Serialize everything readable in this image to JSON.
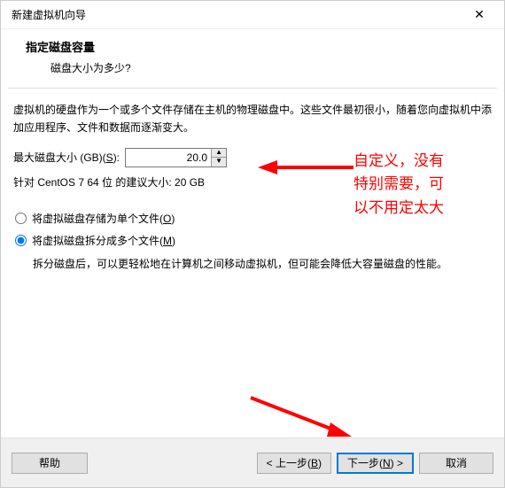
{
  "window": {
    "title": "新建虚拟机向导"
  },
  "header": {
    "title": "指定磁盘容量",
    "subtitle": "磁盘大小为多少?"
  },
  "body": {
    "desc": "虚拟机的硬盘作为一个或多个文件存储在主机的物理磁盘中。这些文件最初很小，随着您向虚拟机中添加应用程序、文件和数据而逐渐变大。",
    "size_label_pre": "最大磁盘大小 (GB)(",
    "size_label_key": "S",
    "size_label_post": "):",
    "size_value": "20.0",
    "suggest": "针对 CentOS 7 64 位 的建议大小: 20 GB",
    "radio_single_pre": "将虚拟磁盘存储为单个文件(",
    "radio_single_key": "O",
    "radio_single_post": ")",
    "radio_split_pre": "将虚拟磁盘拆分成多个文件(",
    "radio_split_key": "M",
    "radio_split_post": ")",
    "split_desc": "拆分磁盘后，可以更轻松地在计算机之间移动虚拟机，但可能会降低大容量磁盘的性能。"
  },
  "annotation": {
    "line1": "自定义，没有",
    "line2": "特别需要，可",
    "line3": "以不用定太大"
  },
  "footer": {
    "help": "帮助",
    "back_pre": "< 上一步(",
    "back_key": "B",
    "back_post": ")",
    "next_pre": "下一步(",
    "next_key": "N",
    "next_post": ") >",
    "cancel": "取消"
  },
  "colors": {
    "annotation": "#ff0000"
  }
}
